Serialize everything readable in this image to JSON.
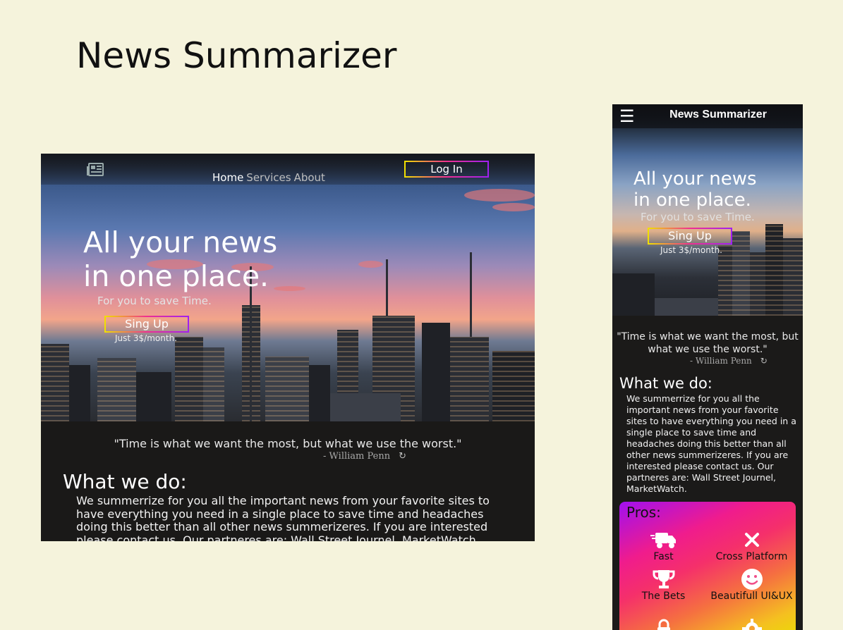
{
  "page": {
    "title": "News Summarizer"
  },
  "desktop": {
    "nav": {
      "logo_icon": "newspaper-icon",
      "links": [
        "Home",
        "Services",
        "About"
      ],
      "login_label": "Log In"
    },
    "hero": {
      "headline_line1": "All your news",
      "headline_line2": "in one place.",
      "subheadline": "For you to save Time.",
      "signup_label": "Sing Up",
      "price_note": "Just 3$/month."
    },
    "quote": {
      "text": "\"Time is what we want the most, but what we use the worst.\"",
      "author": "- William Penn",
      "refresh_icon": "refresh-icon"
    },
    "what_we_do": {
      "title": "What we do:",
      "text": "We summerrize for you all the important news from your favorite sites to have everything you need in a single place to save time and headaches doing this better than all other news summerizeres. If you are interested please contact us. Our partneres are: Wall Street Journel, MarketWatch."
    }
  },
  "mobile": {
    "topbar": {
      "menu_icon": "hamburger-menu-icon",
      "title": "News Summarizer"
    },
    "hero": {
      "headline_line1": "All your news",
      "headline_line2": "in one place.",
      "subheadline": "For you to save Time.",
      "signup_label": "Sing Up",
      "price_note": "Just 3$/month."
    },
    "quote": {
      "text": "\"Time is what we want the most, but what we use the worst.\"",
      "author": "- William Penn"
    },
    "what_we_do": {
      "title": "What we do:",
      "text": "We summerrize for you all the important news from your favorite sites to have everything you need in a single place to save time and headaches doing this better than all other news summerizeres. If you are interested please contact us. Our partneres are: Wall Street Journel, MarketWatch."
    },
    "pros": {
      "title": "Pros:",
      "items": [
        {
          "label": "Fast",
          "icon": "truck-icon"
        },
        {
          "label": "Cross Platform",
          "icon": "close-icon"
        },
        {
          "label": "The Bets",
          "icon": "trophy-icon"
        },
        {
          "label": "Beautifull UI&UX",
          "icon": "smiley-icon"
        }
      ]
    }
  },
  "colors": {
    "page_background": "#f5f3dc",
    "dark_section": "#1a1918",
    "button_gradient": [
      "#f0e000",
      "#f03090",
      "#a020f0"
    ],
    "pros_gradient": [
      "#a010f0",
      "#f01c8c",
      "#f57040",
      "#e8e000"
    ]
  }
}
